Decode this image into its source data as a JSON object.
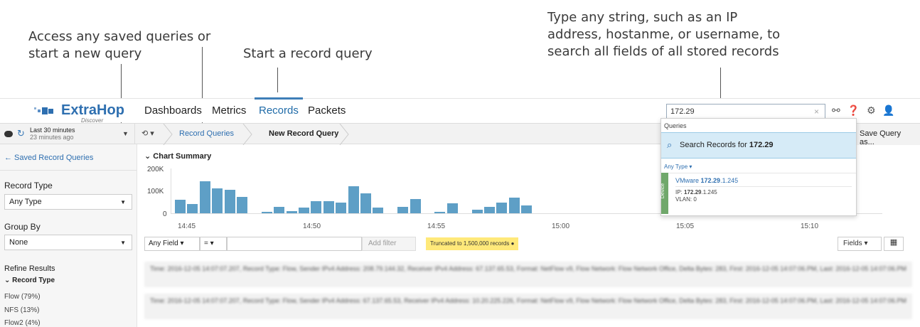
{
  "annotations": {
    "saved_queries": "Access any saved queries or\nstart a new query",
    "record_query": "Start a record query",
    "search": "Type any string, such as an IP\naddress, hostanme, or username, to\nsearch all fields of all stored records"
  },
  "logo": {
    "brand": "ExtraHop",
    "sub": "Discover"
  },
  "nav": {
    "tabs": [
      "Dashboards",
      "Metrics",
      "Records",
      "Packets"
    ],
    "active": "Records"
  },
  "search": {
    "value": "172.29",
    "clear": "×"
  },
  "top_icons": [
    "network-icon",
    "help-icon",
    "settings-icon",
    "user-icon"
  ],
  "time": {
    "label": "Last 30 minutes",
    "sub": "23 minutes ago"
  },
  "breadcrumb": {
    "history": "⟲ ▾",
    "parent": "Record Queries",
    "current": "New Record Query"
  },
  "save_button": "Save Query as...",
  "sidebar": {
    "back": "← Saved Record Queries",
    "record_type_label": "Record Type",
    "record_type_value": "Any Type",
    "group_by_label": "Group By",
    "group_by_value": "None",
    "refine_label": "Refine Results",
    "refine_group": "Record Type",
    "refine_items": [
      "Flow  (79%)",
      "NFS  (13%)",
      "Flow2  (4%)"
    ]
  },
  "chart_title": "Chart Summary",
  "chart_data": {
    "type": "bar",
    "title": "Chart Summary",
    "ylim": [
      0,
      200000
    ],
    "yticks": [
      "200K",
      "100K",
      "0"
    ],
    "xticks": [
      "14:45",
      "14:50",
      "14:55",
      "15:00",
      "15:05",
      "15:10"
    ],
    "values": [
      62000,
      42000,
      145000,
      112000,
      108000,
      75000,
      0,
      8000,
      30000,
      10000,
      25000,
      55000,
      55000,
      47000,
      122000,
      90000,
      25000,
      0,
      30000,
      65000,
      0,
      8000,
      45000,
      0,
      15000,
      30000,
      50000,
      70000,
      35000
    ]
  },
  "filter": {
    "field": "Any Field  ▾",
    "op": "=  ▾",
    "add": "Add filter",
    "truncated": "Truncated to 1,500,000 records",
    "fields_btn": "Fields  ▾",
    "grid_icon": "▦"
  },
  "records": [
    "Time: 2016-12-05 14:07:07.207, Record Type: Flow, Sender IPv4 Address: 208.79.144.32, Receiver IPv4 Address: 67.137.65.53, Format: NetFlow v9, Flow Network: Flow Network Office, Delta Bytes: 283, First: 2016-12-05 14:07:06.PM, Last: 2016-12-05 14:07:06.PM",
    "Time: 2016-12-05 14:07:07.207, Record Type: Flow, Sender IPv4 Address: 67.137.65.53, Receiver IPv4 Address: 10.20.225.226, Format: NetFlow v9, Flow Network: Flow Network Office, Delta Bytes: 283, First: 2016-12-05 14:07:06.PM, Last: 2016-12-05 14:07:06.PM"
  ],
  "dropdown": {
    "header": "Queries",
    "search_prefix": "Search Records for",
    "search_term": "172.29",
    "type": "Any Type ▾",
    "tag": "Device",
    "result_name_prefix": "VMware",
    "result_name_bold": "172.29",
    "result_name_suffix": ".1.245",
    "ip_prefix": "IP:",
    "ip_bold": "172.29",
    "ip_suffix": ".1.245",
    "vlan": "VLAN: 0"
  }
}
